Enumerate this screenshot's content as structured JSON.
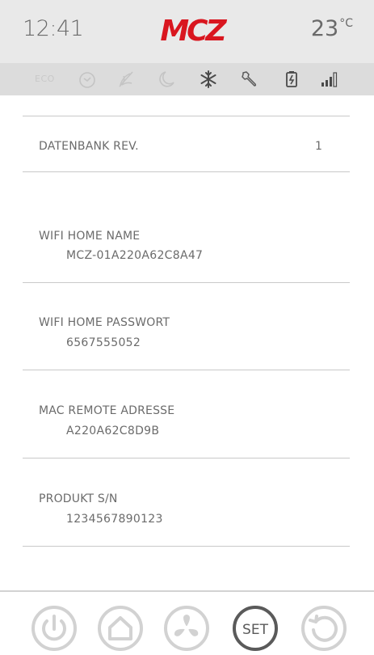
{
  "header": {
    "time": "12:41",
    "brand": "MCZ",
    "temperature": "23",
    "temperature_unit": "°C",
    "brand_color": "#d9161f"
  },
  "status_bar": {
    "eco_label": "ECO",
    "icons": [
      "clock-icon",
      "fan-off-icon",
      "moon-icon",
      "snowflake-icon",
      "wrench-icon",
      "battery-charging-icon",
      "signal-icon"
    ]
  },
  "info": {
    "db_rev_label": "DATENBANK REV.",
    "db_rev_value": "1",
    "wifi_name_label": "WIFI HOME NAME",
    "wifi_name_value": "MCZ-01A220A62C8A47",
    "wifi_password_label": "WIFI HOME PASSWORT",
    "wifi_password_value": "6567555052",
    "mac_label": "MAC REMOTE ADRESSE",
    "mac_value": "A220A62C8D9B",
    "serial_label": "PRODUKT S/N",
    "serial_value": "1234567890123"
  },
  "nav": {
    "set_label": "SET",
    "icons": [
      "power-icon",
      "home-icon",
      "fan-icon",
      "set-button",
      "back-icon"
    ]
  }
}
